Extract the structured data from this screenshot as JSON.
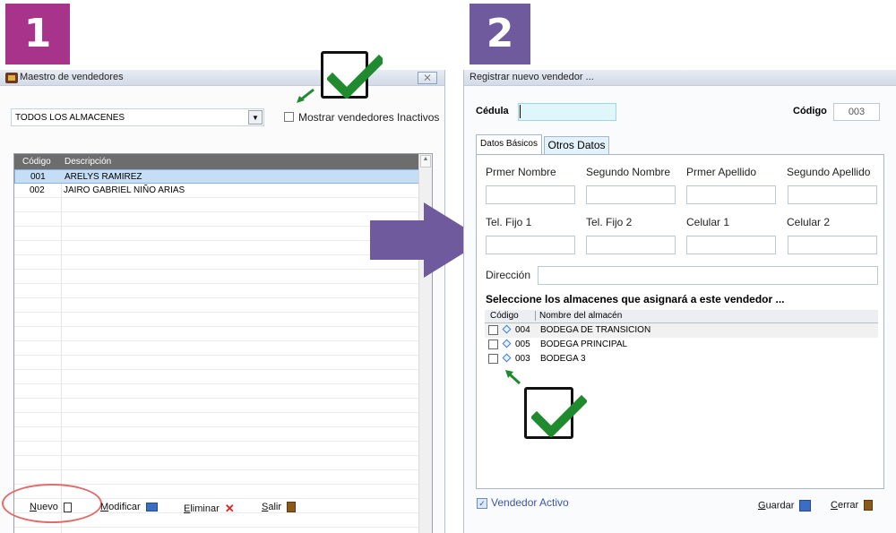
{
  "badges": {
    "one": "1",
    "two": "2"
  },
  "window1": {
    "title": "Maestro de vendedores",
    "close_label": "⨉",
    "store_combo": "TODOS LOS ALMACENES",
    "show_inactive_label": "Mostrar vendedores Inactivos",
    "grid": {
      "columns": [
        "Código",
        "Descripción"
      ],
      "rows": [
        {
          "code": "001",
          "desc": "ARELYS RAMIREZ"
        },
        {
          "code": "002",
          "desc": "JAIRO GABRIEL NIÑO ARIAS"
        }
      ]
    },
    "buttons": {
      "nuevo": {
        "first": "N",
        "rest": "uevo"
      },
      "modificar": {
        "first": "M",
        "rest": "odificar"
      },
      "eliminar": {
        "first": "E",
        "rest": "liminar"
      },
      "salir": {
        "first": "S",
        "rest": "alir"
      }
    }
  },
  "window2": {
    "title": "Registrar nuevo vendedor ...",
    "cedula_label": "Cédula",
    "codigo_label": "Código",
    "codigo_value": "003",
    "tabs": [
      "Datos Básicos",
      "Otros Datos"
    ],
    "fields": {
      "primer_nombre": "Prmer Nombre",
      "segundo_nombre": "Segundo Nombre",
      "primer_apellido": "Prmer Apellido",
      "segundo_apellido": "Segundo Apellido",
      "tel1": "Tel. Fijo 1",
      "tel2": "Tel. Fijo 2",
      "cel1": "Celular 1",
      "cel2": "Celular 2",
      "direccion": "Dirección"
    },
    "warehouses_heading": "Seleccione los almacenes que asignará a este vendedor ...",
    "warehouse_columns": [
      "Código",
      "Nombre del almacén"
    ],
    "warehouses": [
      {
        "code": "004",
        "name": "BODEGA DE TRANSICION"
      },
      {
        "code": "005",
        "name": "BODEGA PRINCIPAL"
      },
      {
        "code": "003",
        "name": "BODEGA 3"
      }
    ],
    "activo_label": "Vendedor Activo",
    "buttons": {
      "guardar": {
        "first": "G",
        "rest": "uardar"
      },
      "cerrar": {
        "first": "C",
        "rest": "errar"
      }
    }
  },
  "colors": {
    "badge1": "#a8338b",
    "badge2": "#6f5a9d",
    "check_green": "#1f8a2e",
    "arrow_purple": "#6f5a9d"
  }
}
